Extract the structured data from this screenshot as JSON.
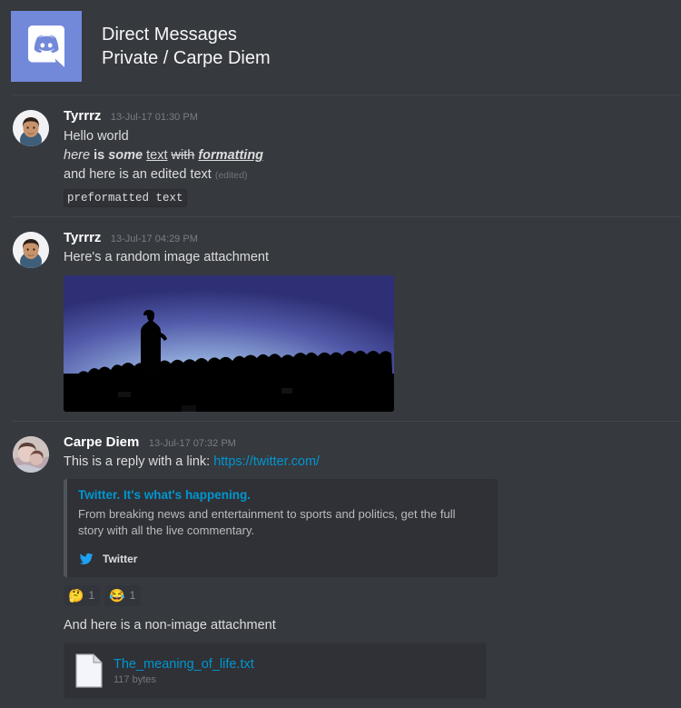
{
  "header": {
    "icon": "discord-logo",
    "title": "Direct Messages",
    "subtitle": "Private / Carpe Diem",
    "brand_color": "#7289da"
  },
  "messages": [
    {
      "author": "Tyrrrz",
      "timestamp": "13-Jul-17 01:30 PM",
      "lines": {
        "plain": "Hello world",
        "fmt_here": "here",
        "fmt_is": "is",
        "fmt_some": "some",
        "fmt_text": "text",
        "fmt_with": "with",
        "fmt_formatting": "formatting",
        "edited_text": "and here is an edited text",
        "edited_marker": "(edited)",
        "preformatted": "preformatted text"
      }
    },
    {
      "author": "Tyrrrz",
      "timestamp": "13-Jul-17 04:29 PM",
      "lines": {
        "plain": "Here's a random image attachment"
      },
      "image_attachment": "crowd-silhouette-image"
    },
    {
      "author": "Carpe Diem",
      "timestamp": "13-Jul-17 07:32 PM",
      "lines": {
        "reply_prefix": "This is a reply with a link: ",
        "link_text": "https://twitter.com/",
        "attachment_intro": "And here is a non-image attachment"
      },
      "embed": {
        "title": "Twitter. It's what's happening.",
        "description": "From breaking news and entertainment to sports and politics, get the full story with all the live commentary.",
        "footer_icon": "twitter-bird-icon",
        "footer_text": "Twitter",
        "title_color": "#0096cf",
        "bar_color": "#4f545c"
      },
      "reactions": [
        {
          "emoji": "🤔",
          "name": "thinking-face",
          "count": "1"
        },
        {
          "emoji": "😂",
          "name": "face-with-tears-of-joy",
          "count": "1"
        }
      ],
      "file_attachment": {
        "name": "The_meaning_of_life.txt",
        "size": "117 bytes",
        "icon": "document-icon"
      }
    }
  ],
  "colors": {
    "background": "#36393e",
    "link": "#0096cf",
    "muted": "#72767d",
    "divider": "#42454a",
    "embed_background": "#2f3136"
  }
}
